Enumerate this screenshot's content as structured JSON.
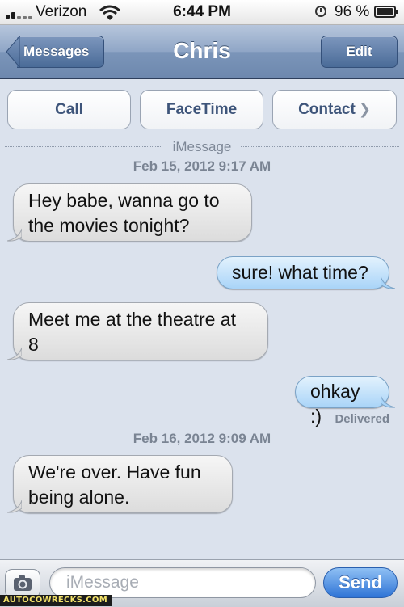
{
  "status_bar": {
    "carrier": "Verizon",
    "time": "6:44 PM",
    "battery": "96 %",
    "battery_level": 0.96
  },
  "nav": {
    "back_label": "Messages",
    "title": "Chris",
    "edit_label": "Edit"
  },
  "actions": {
    "call": "Call",
    "facetime": "FaceTime",
    "contact": "Contact"
  },
  "conversation": {
    "service_label": "iMessage",
    "timestamp_1": "Feb 15, 2012 9:17 AM",
    "messages": [
      {
        "from": "them",
        "text_lines": [
          "Hey babe, wanna go to",
          "the movies tonight?"
        ]
      },
      {
        "from": "me",
        "text_lines": [
          "sure! what time?"
        ]
      },
      {
        "from": "them",
        "text_lines": [
          "Meet me at the theatre at",
          "8"
        ]
      },
      {
        "from": "me",
        "text_lines": [
          "ohkay :)"
        ]
      },
      {
        "from": "them",
        "text_lines": [
          "We're over. Have fun",
          "being alone."
        ]
      }
    ],
    "delivered": "Delivered",
    "timestamp_2": "Feb 16, 2012 9:09 AM"
  },
  "input": {
    "placeholder": "iMessage",
    "send_label": "Send"
  },
  "watermark": "AUTOCOWRECKS.COM",
  "colors": {
    "nav_blue": "#6d88ae",
    "incoming_bubble": "#e6e6e6",
    "outgoing_bubble": "#a9d4f8",
    "send_blue": "#2f74d6",
    "background": "#dbe2ed"
  },
  "icons": {
    "wifi": "wifi-icon",
    "lock": "rotation-lock-icon",
    "battery": "battery-icon",
    "camera": "camera-icon",
    "chevron": "chevron-right-icon"
  }
}
